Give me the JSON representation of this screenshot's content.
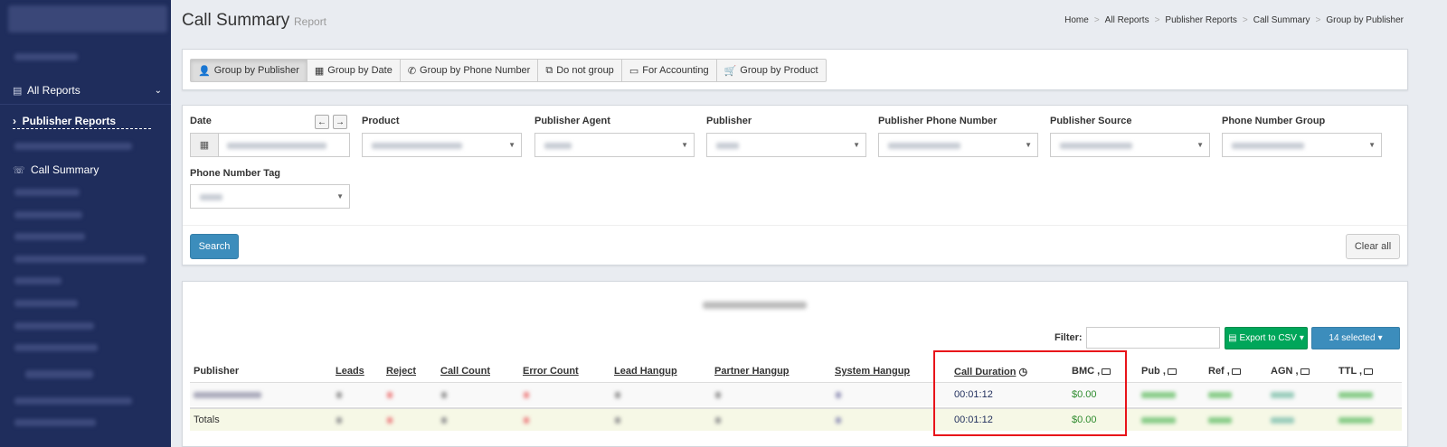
{
  "header": {
    "title": "Call Summary",
    "subtitle": "Report",
    "breadcrumbs": [
      "Home",
      "All Reports",
      "Publisher Reports",
      "Call Summary",
      "Group by Publisher"
    ]
  },
  "sidebar": {
    "all_reports": "All Reports",
    "publisher_reports": "Publisher Reports",
    "call_summary": "Call Summary"
  },
  "grouping": [
    {
      "label": "Group by Publisher",
      "icon": "user-icon",
      "active": true
    },
    {
      "label": "Group by Date",
      "icon": "calendar-icon"
    },
    {
      "label": "Group by Phone Number",
      "icon": "phone-icon"
    },
    {
      "label": "Do not group",
      "icon": "ungroup-icon"
    },
    {
      "label": "For Accounting",
      "icon": "card-icon"
    },
    {
      "label": "Group by Product",
      "icon": "cart-icon"
    }
  ],
  "filters": {
    "date": "Date",
    "product": "Product",
    "publisher_agent": "Publisher Agent",
    "publisher": "Publisher",
    "publisher_phone_number": "Publisher Phone Number",
    "publisher_source": "Publisher Source",
    "phone_number_group": "Phone Number Group",
    "phone_number_tag": "Phone Number Tag",
    "search_label": "Search",
    "clear_label": "Clear all"
  },
  "table_tools": {
    "filter_label": "Filter:",
    "export_label": "Export to CSV",
    "selected_label": "14 selected"
  },
  "table": {
    "columns": {
      "publisher": "Publisher",
      "leads": "Leads",
      "reject": "Reject",
      "call_count": "Call Count",
      "error_count": "Error Count",
      "lead_hangup": "Lead Hangup",
      "partner_hangup": "Partner Hangup",
      "system_hangup": "System Hangup",
      "call_duration": "Call Duration",
      "bmc": "BMC ,",
      "pub": "Pub ,",
      "ref": "Ref ,",
      "agn": "AGN ,",
      "ttl": "TTL ,"
    },
    "row1": {
      "call_duration": "00:01:12",
      "bmc": "$0.00"
    },
    "totals": {
      "label": "Totals",
      "call_duration": "00:01:12",
      "bmc": "$0.00"
    }
  },
  "colors": {
    "sidebar": "#1f2d5c",
    "primary": "#3c8dbc",
    "success": "#00a65a",
    "highlight": "#e8141a"
  }
}
